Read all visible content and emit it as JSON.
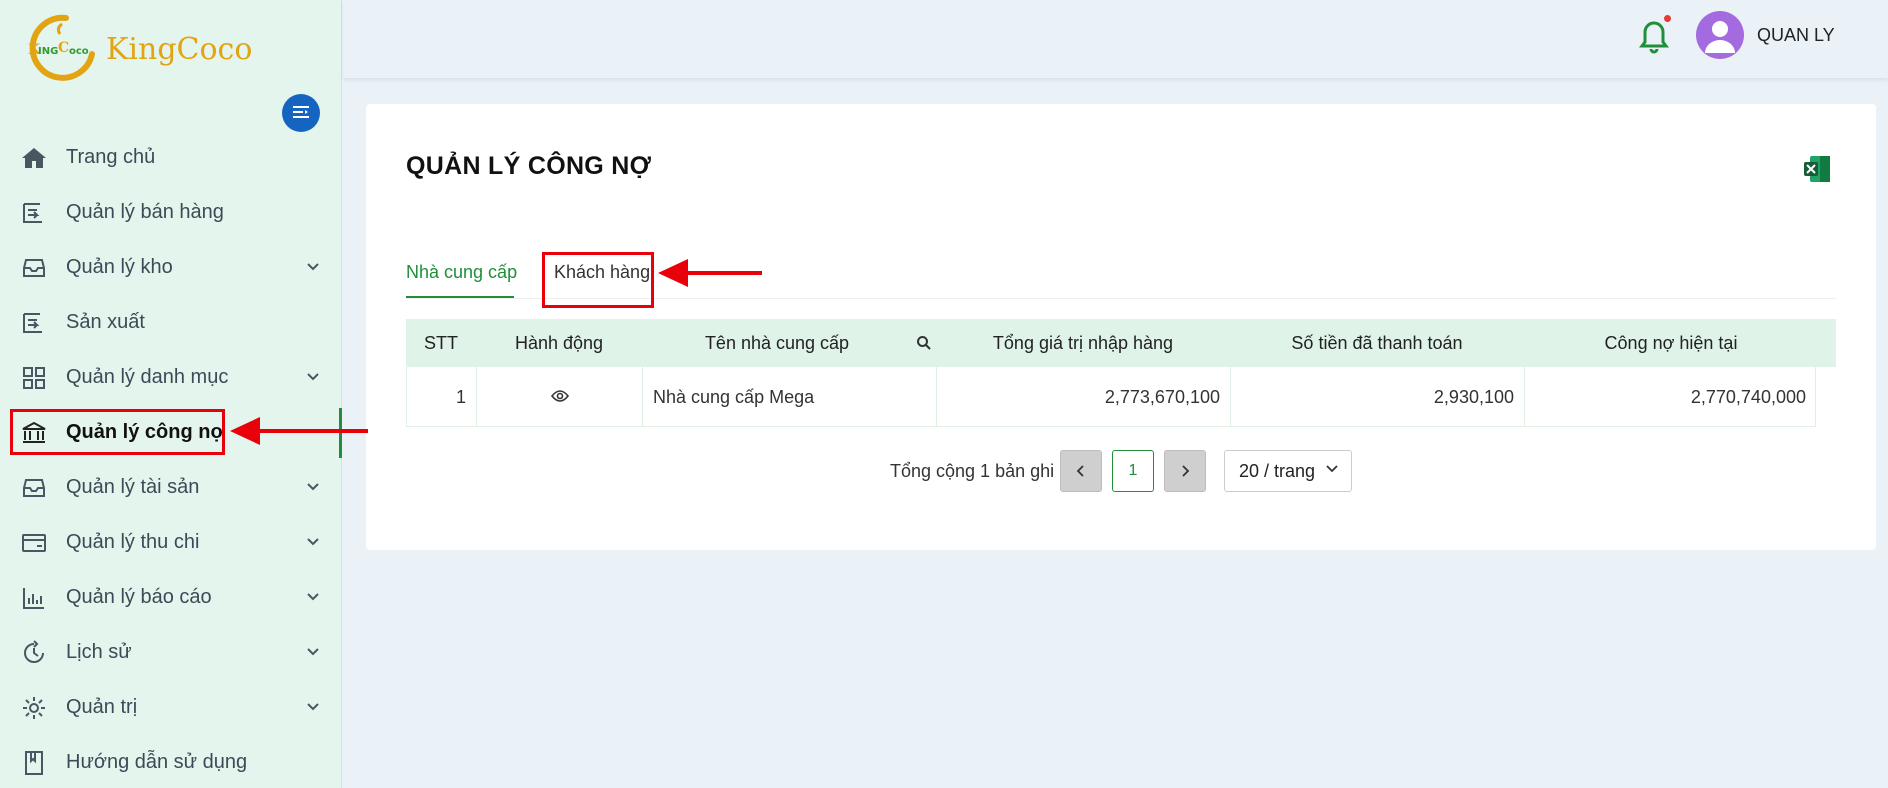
{
  "app": {
    "logo_text": "KingCoco",
    "logo_mark_text": "KingCoco"
  },
  "sidebar": {
    "items": [
      {
        "label": "Trang chủ",
        "icon": "home-icon",
        "has_children": false
      },
      {
        "label": "Quản lý bán hàng",
        "icon": "sales-icon",
        "has_children": false
      },
      {
        "label": "Quản lý kho",
        "icon": "warehouse-icon",
        "has_children": true
      },
      {
        "label": "Sản xuất",
        "icon": "production-icon",
        "has_children": false
      },
      {
        "label": "Quản lý danh mục",
        "icon": "category-grid-icon",
        "has_children": true
      },
      {
        "label": "Quản lý công nợ",
        "icon": "bank-icon",
        "has_children": false,
        "active": true
      },
      {
        "label": "Quản lý tài sản",
        "icon": "asset-box-icon",
        "has_children": true
      },
      {
        "label": "Quản lý thu chi",
        "icon": "wallet-card-icon",
        "has_children": true
      },
      {
        "label": "Quản lý báo cáo",
        "icon": "bar-chart-icon",
        "has_children": true
      },
      {
        "label": "Lịch sử",
        "icon": "history-clock-icon",
        "has_children": true
      },
      {
        "label": "Quản trị",
        "icon": "gear-icon",
        "has_children": true
      },
      {
        "label": "Hướng dẫn sử dụng",
        "icon": "book-icon",
        "has_children": false
      }
    ]
  },
  "header": {
    "user_name": "QUAN LY",
    "bell_icon": "bell-icon",
    "has_notification": true
  },
  "main": {
    "title": "QUẢN LÝ CÔNG NỢ",
    "export_icon": "excel-icon",
    "tabs": [
      {
        "label": "Nhà cung cấp",
        "active": true
      },
      {
        "label": "Khách hàng",
        "active": false
      }
    ],
    "table": {
      "columns": [
        "STT",
        "Hành động",
        "Tên nhà cung cấp",
        "Tổng giá trị nhập hàng",
        "Số tiền đã thanh toán",
        "Công nợ hiện tại"
      ],
      "rows": [
        {
          "stt": "1",
          "name": "Nhà cung cấp Mega",
          "total_import": "2,773,670,100",
          "paid": "2,930,100",
          "debt": "2,770,740,000"
        }
      ]
    },
    "pagination": {
      "total_text": "Tổng cộng 1 bản ghi",
      "current_page": "1",
      "page_size": "20 / trang"
    }
  },
  "colors": {
    "accent_green": "#1f8f3a",
    "sidebar_bg": "#e4f5ed",
    "annotation_red": "#e8000b"
  }
}
